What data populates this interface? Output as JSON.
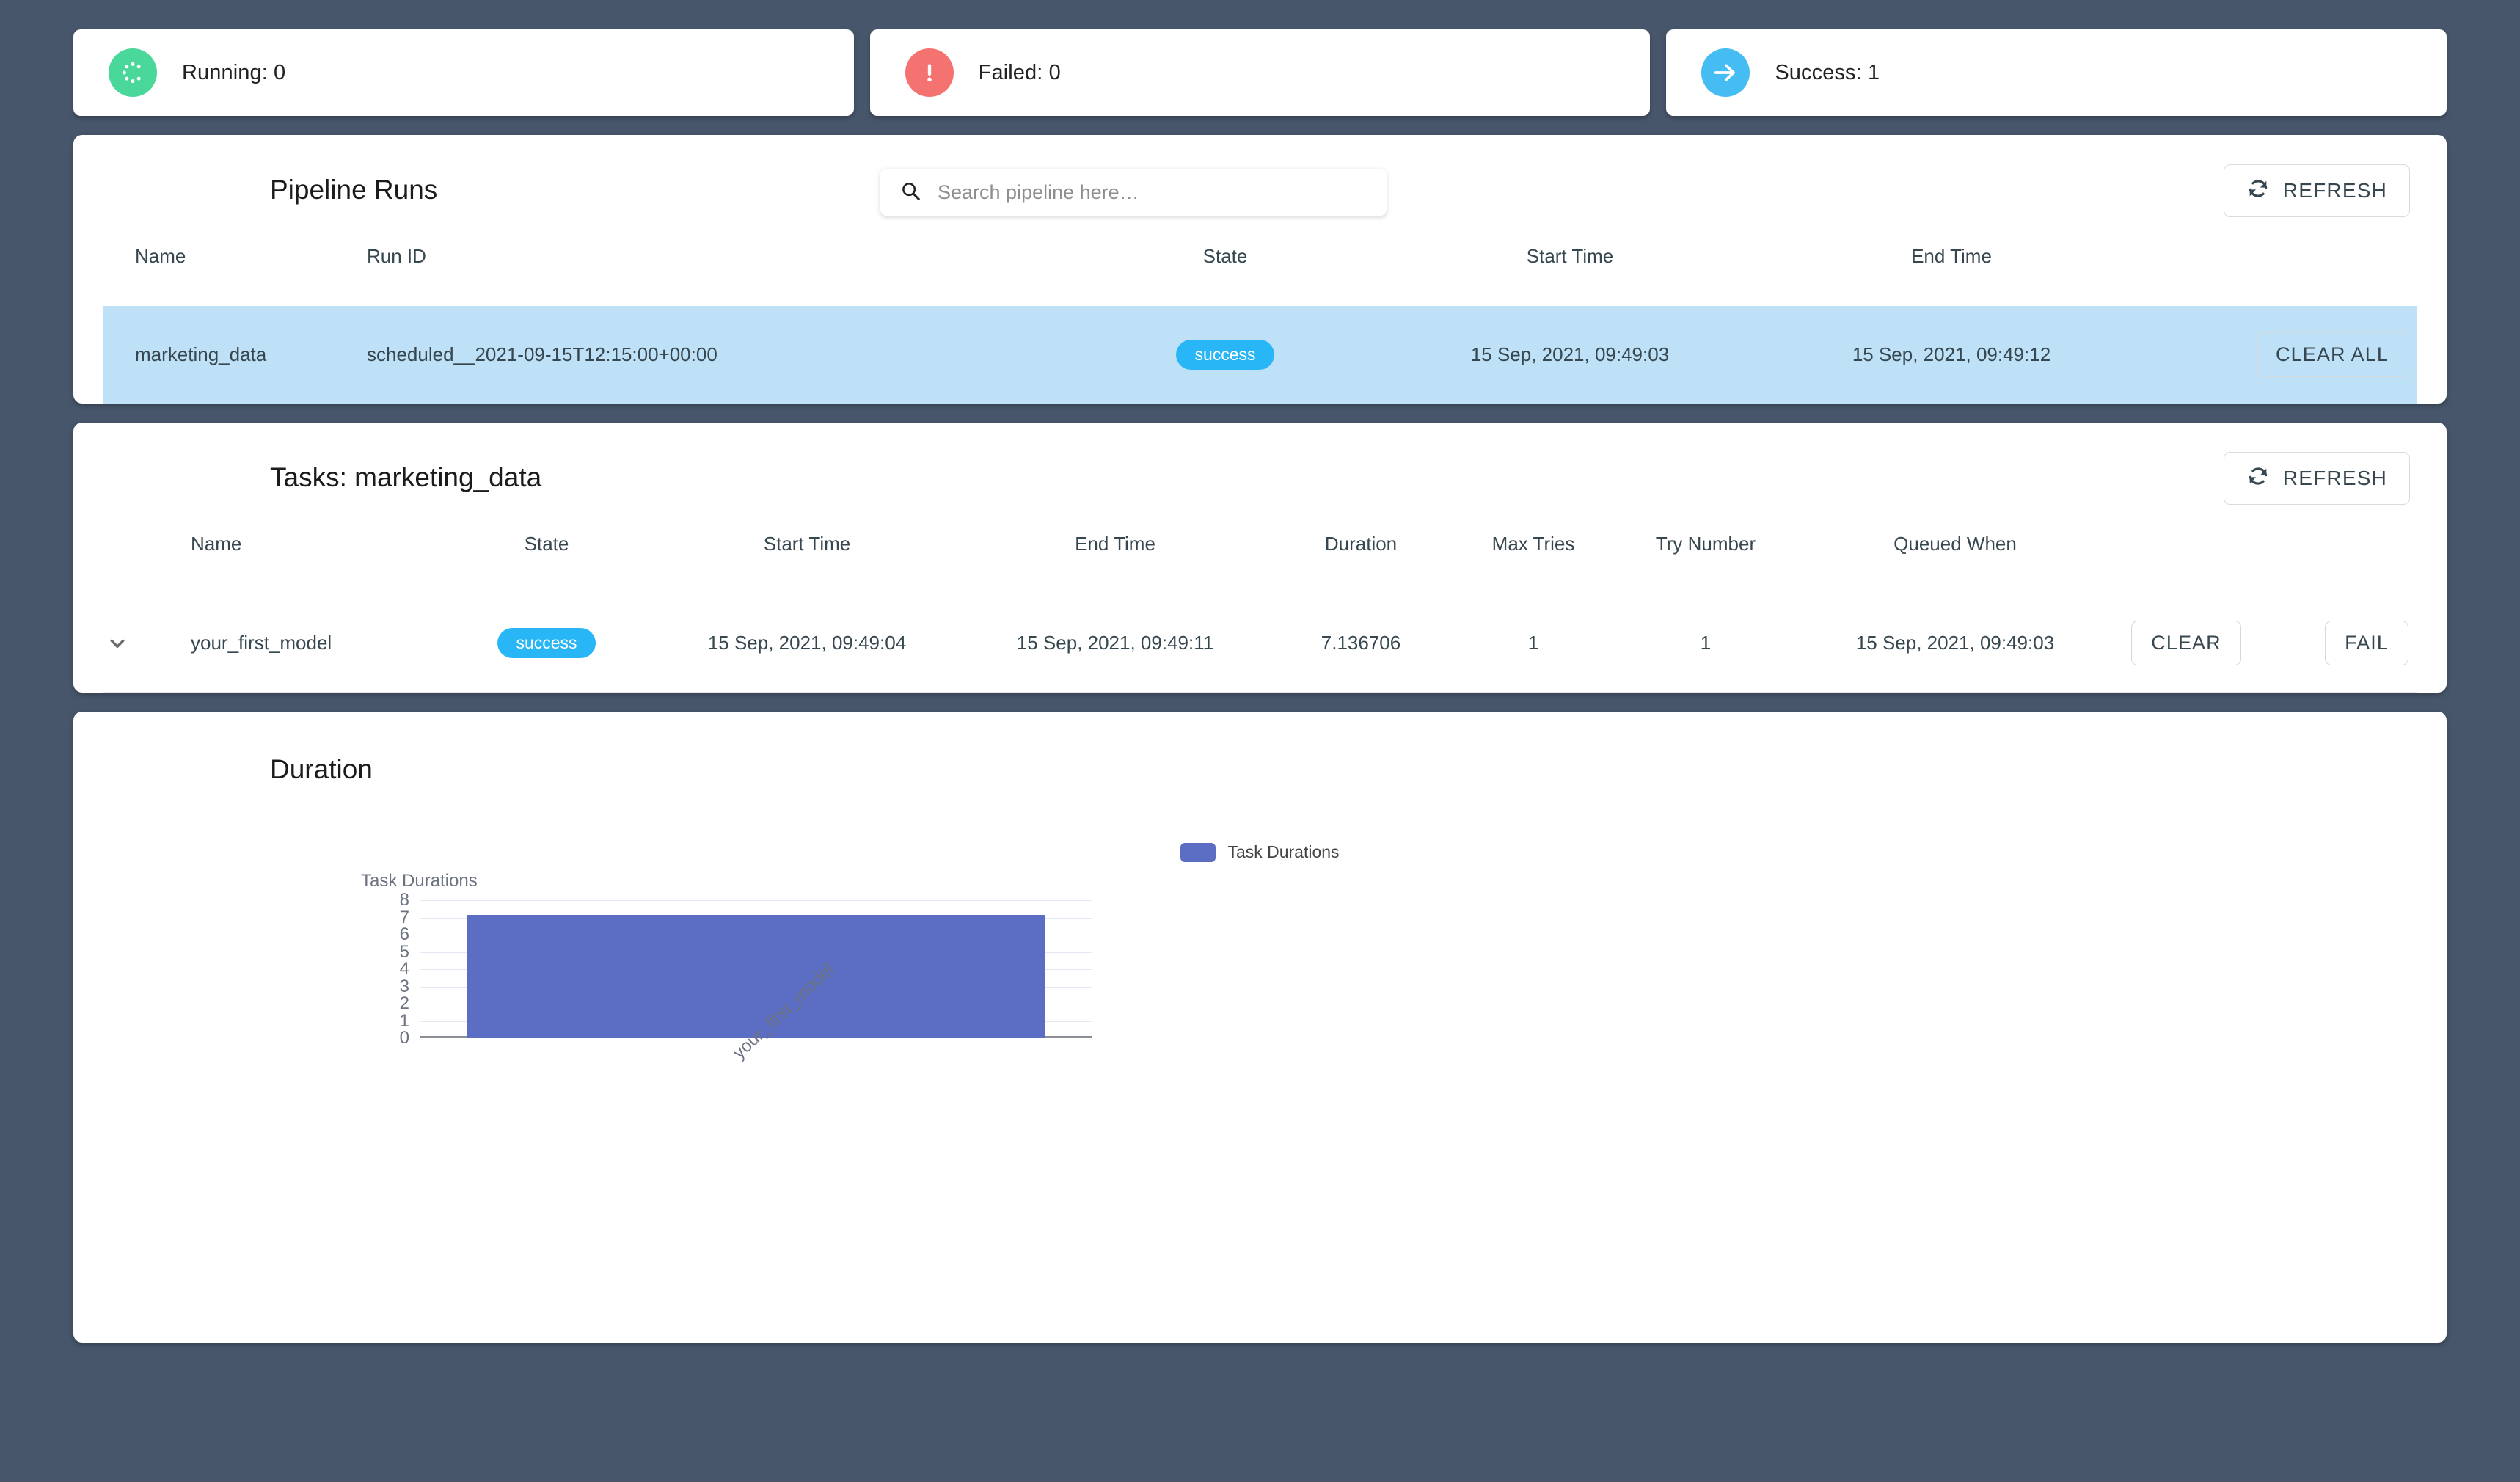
{
  "status_cards": [
    {
      "icon": "spinner-icon",
      "label": "Running: 0",
      "color": "#49d79a"
    },
    {
      "icon": "alert-icon",
      "label": "Failed: 0",
      "color": "#f4726f"
    },
    {
      "icon": "arrow-right-icon",
      "label": "Success: 1",
      "color": "#45bdf3"
    }
  ],
  "pipeline_runs": {
    "title": "Pipeline Runs",
    "search": {
      "placeholder": "Search pipeline here…",
      "value": ""
    },
    "refresh_label": "REFRESH",
    "columns": [
      "Name",
      "Run ID",
      "State",
      "Start Time",
      "End Time",
      ""
    ],
    "rows": [
      {
        "name": "marketing_data",
        "run_id": "scheduled__2021-09-15T12:15:00+00:00",
        "state": "success",
        "start_time": "15 Sep, 2021, 09:49:03",
        "end_time": "15 Sep, 2021, 09:49:12",
        "action": "CLEAR ALL"
      }
    ]
  },
  "tasks": {
    "title": "Tasks: marketing_data",
    "refresh_label": "REFRESH",
    "columns": [
      "",
      "Name",
      "State",
      "Start Time",
      "End Time",
      "Duration",
      "Max Tries",
      "Try Number",
      "Queued When",
      "",
      ""
    ],
    "rows": [
      {
        "expand": "chevron-down-icon",
        "name": "your_first_model",
        "state": "success",
        "start_time": "15 Sep, 2021, 09:49:04",
        "end_time": "15 Sep, 2021, 09:49:11",
        "duration": "7.136706",
        "max_tries": "1",
        "try_number": "1",
        "queued_when": "15 Sep, 2021, 09:49:03",
        "action_clear": "CLEAR",
        "action_fail": "FAIL"
      }
    ]
  },
  "duration_panel": {
    "title": "Duration"
  },
  "chart_data": {
    "type": "bar",
    "title": "",
    "legend": [
      "Task Durations"
    ],
    "legend_position": "top-center",
    "ylabel": "Task Durations",
    "xlabel": "",
    "categories": [
      "your_first_model"
    ],
    "values": [
      7.136706
    ],
    "ylim": [
      0,
      8
    ],
    "yticks": [
      8,
      7,
      6,
      5,
      4,
      3,
      2,
      1,
      0
    ],
    "grid": true,
    "series_color": "#5b6ec4"
  },
  "colors": {
    "background": "#47566b",
    "panel": "#ffffff",
    "row_highlight": "#bfe1f8",
    "chip": "#29b6f6",
    "text": "#37474f",
    "bar": "#5b6ec4"
  }
}
